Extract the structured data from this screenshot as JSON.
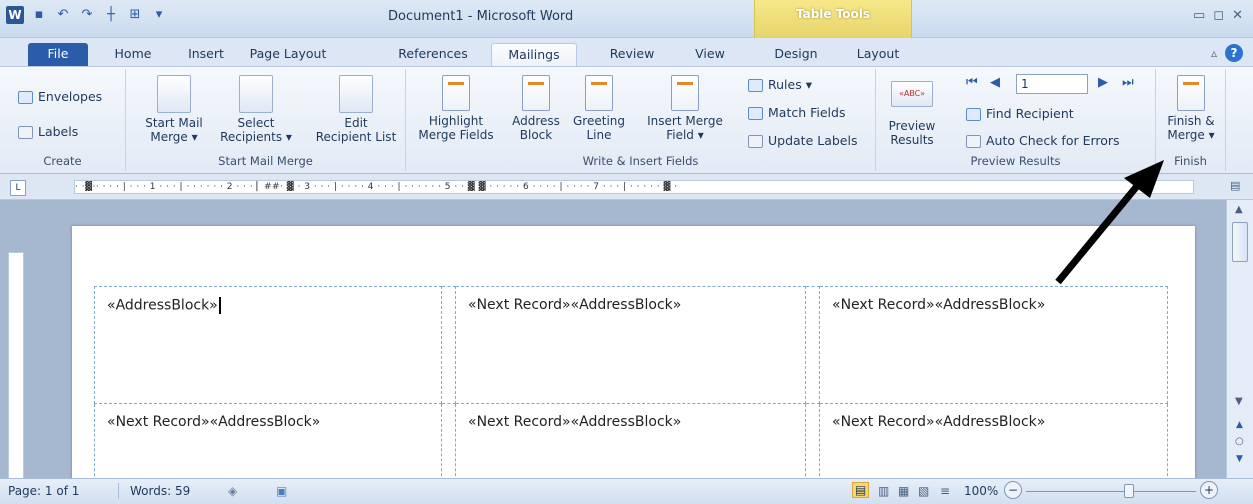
{
  "window": {
    "title": "Document1 - Microsoft Word",
    "contextual_tab_group": "Table Tools",
    "quick_access": [
      "word-logo",
      "save-icon",
      "undo-icon",
      "redo-icon",
      "insert-table-icon",
      "org-chart-icon",
      "customize-icon"
    ],
    "controls": [
      "minimize-icon",
      "restore-icon",
      "close-icon"
    ]
  },
  "tabs": [
    "File",
    "Home",
    "Insert",
    "Page Layout",
    "References",
    "Mailings",
    "Review",
    "View",
    "Design",
    "Layout"
  ],
  "active_tab": "Mailings",
  "ribbon": {
    "create": {
      "label": "Create",
      "envelopes": "Envelopes",
      "labels": "Labels"
    },
    "start_mail_merge": {
      "label": "Start Mail Merge",
      "start_l1": "Start Mail",
      "start_l2": "Merge ▾",
      "select_l1": "Select",
      "select_l2": "Recipients ▾",
      "edit_l1": "Edit",
      "edit_l2": "Recipient List"
    },
    "write_insert": {
      "label": "Write & Insert Fields",
      "highlight_l1": "Highlight",
      "highlight_l2": "Merge Fields",
      "address_l1": "Address",
      "address_l2": "Block",
      "greeting_l1": "Greeting",
      "greeting_l2": "Line",
      "insert_l1": "Insert Merge",
      "insert_l2": "Field ▾",
      "rules": "Rules ▾",
      "match": "Match Fields",
      "update": "Update Labels"
    },
    "preview_results": {
      "label": "Preview Results",
      "preview_l1": "Preview",
      "preview_l2": "Results",
      "record": "1",
      "find": "Find Recipient",
      "auto_check": "Auto Check for Errors",
      "badge": "«ABC»"
    },
    "finish": {
      "label": "Finish",
      "finish_l1": "Finish &",
      "finish_l2": "Merge ▾"
    }
  },
  "ruler": {
    "text": "· ·▓·· · · · | · · · 1 · · · | · · · · · · 2 · · · ▏##· ▓ · 3 · · · | · · · · 4 · · · | · · · · · · 5 · · ▓ ▓ · · · · · 6 · · · · | · · · · 7 · · · | · · · · · ▓ ·",
    "tab_selector": "L"
  },
  "document": {
    "cells": [
      "«AddressBlock»",
      "«Next Record»«AddressBlock»",
      "«Next Record»«AddressBlock»",
      "«Next Record»«AddressBlock»",
      "«Next Record»«AddressBlock»",
      "«Next Record»«AddressBlock»"
    ]
  },
  "status": {
    "page": "Page: 1 of 1",
    "words": "Words: 59",
    "zoom": "100%",
    "minus": "−",
    "plus": "+"
  },
  "colors": {
    "accent": "#2a5caa",
    "table_tools": "#e7d36a",
    "page_bg": "#a6b7d0"
  }
}
